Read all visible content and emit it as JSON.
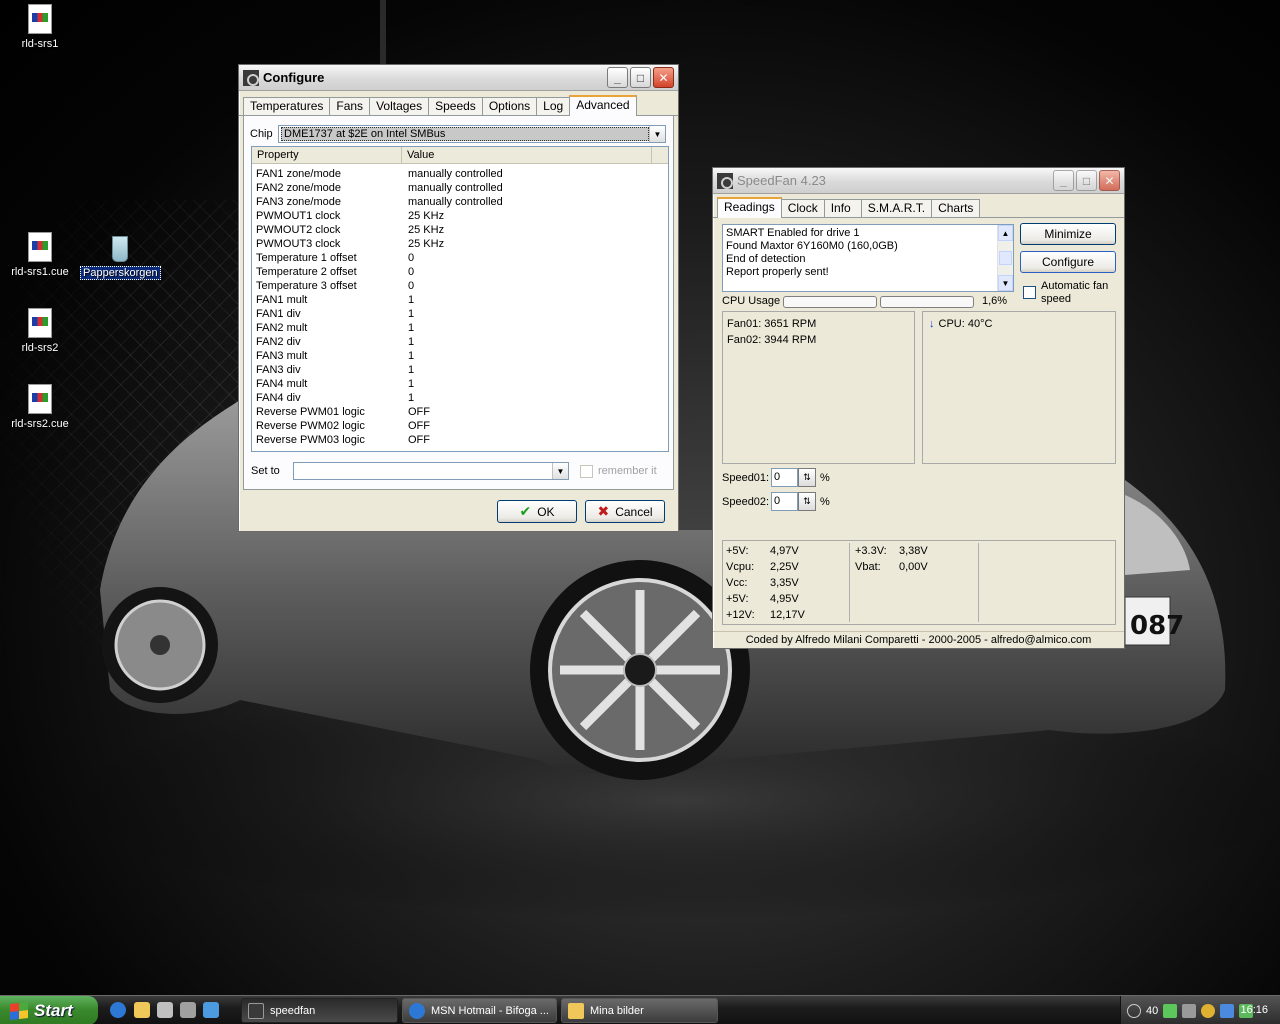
{
  "desktop": {
    "icons": [
      {
        "label": "rld-srs1"
      },
      {
        "label": "rld-srs1.cue"
      },
      {
        "label": "Papperskorgen"
      },
      {
        "label": "rld-srs2"
      },
      {
        "label": "rld-srs2.cue"
      }
    ],
    "plate_text": "087"
  },
  "configure": {
    "title": "Configure",
    "tabs": [
      "Temperatures",
      "Fans",
      "Voltages",
      "Speeds",
      "Options",
      "Log",
      "Advanced"
    ],
    "active_tab": "Advanced",
    "chip_label": "Chip",
    "chip_value": "DME1737 at $2E on Intel SMBus",
    "columns": {
      "property": "Property",
      "value": "Value"
    },
    "rows": [
      {
        "p": "FAN1 zone/mode",
        "v": "manually controlled"
      },
      {
        "p": "FAN2 zone/mode",
        "v": "manually controlled"
      },
      {
        "p": "FAN3 zone/mode",
        "v": "manually controlled"
      },
      {
        "p": "PWMOUT1 clock",
        "v": "25 KHz"
      },
      {
        "p": "PWMOUT2 clock",
        "v": "25 KHz"
      },
      {
        "p": "PWMOUT3 clock",
        "v": "25 KHz"
      },
      {
        "p": "Temperature 1 offset",
        "v": "0"
      },
      {
        "p": "Temperature 2 offset",
        "v": "0"
      },
      {
        "p": "Temperature 3 offset",
        "v": "0"
      },
      {
        "p": "FAN1 mult",
        "v": "1"
      },
      {
        "p": "FAN1 div",
        "v": "1"
      },
      {
        "p": "FAN2 mult",
        "v": "1"
      },
      {
        "p": "FAN2 div",
        "v": "1"
      },
      {
        "p": "FAN3 mult",
        "v": "1"
      },
      {
        "p": "FAN3 div",
        "v": "1"
      },
      {
        "p": "FAN4 mult",
        "v": "1"
      },
      {
        "p": "FAN4 div",
        "v": "1"
      },
      {
        "p": "Reverse PWM01 logic",
        "v": "OFF"
      },
      {
        "p": "Reverse PWM02 logic",
        "v": "OFF"
      },
      {
        "p": "Reverse PWM03 logic",
        "v": "OFF"
      }
    ],
    "set_to_label": "Set to",
    "set_to_value": "",
    "remember_label": "remember it",
    "ok_label": "OK",
    "cancel_label": "Cancel"
  },
  "speedfan": {
    "title": "SpeedFan 4.23",
    "tabs": [
      "Readings",
      "Clock",
      "Info",
      "S.M.A.R.T.",
      "Charts"
    ],
    "active_tab": "Readings",
    "log_lines": [
      "SMART Enabled for drive 1",
      "Found Maxtor 6Y160M0 (160,0GB)",
      "End of detection",
      "Report properly sent!"
    ],
    "minimize_label": "Minimize",
    "configure_label": "Configure",
    "auto_fan_label": "Automatic fan speed",
    "cpu_usage_label": "CPU Usage",
    "cpu_usage_value": "1,6%",
    "fans": [
      "Fan01: 3651 RPM",
      "Fan02: 3944 RPM"
    ],
    "temps": [
      "CPU: 40°C"
    ],
    "speeds": [
      {
        "label": "Speed01:",
        "value": "0",
        "unit": "%"
      },
      {
        "label": "Speed02:",
        "value": "0",
        "unit": "%"
      }
    ],
    "voltages_col1": [
      {
        "n": "+5V:",
        "v": "4,97V"
      },
      {
        "n": "Vcpu:",
        "v": "2,25V"
      },
      {
        "n": "Vcc:",
        "v": "3,35V"
      },
      {
        "n": "+5V:",
        "v": "4,95V"
      },
      {
        "n": "+12V:",
        "v": "12,17V"
      }
    ],
    "voltages_col2": [
      {
        "n": "+3.3V:",
        "v": "3,38V"
      },
      {
        "n": "Vbat:",
        "v": "0,00V"
      }
    ],
    "footer": "Coded by Alfredo Milani Comparetti - 2000-2005 - alfredo@almico.com"
  },
  "taskbar": {
    "start_label": "Start",
    "tasks": [
      {
        "label": "speedfan"
      },
      {
        "label": "MSN Hotmail - Bifoga ..."
      },
      {
        "label": "Mina bilder"
      }
    ],
    "tray_temp": "40",
    "clock": "16:16"
  }
}
